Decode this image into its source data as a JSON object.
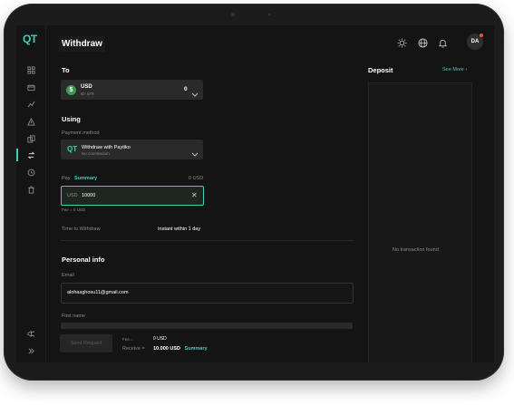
{
  "app": {
    "logo": "QT",
    "page_title": "Withdraw"
  },
  "header": {
    "avatar_initials": "DA"
  },
  "to": {
    "label": "To",
    "currency": {
      "name": "USD",
      "id": "ID: 679",
      "balance": "0",
      "icon": "dollar-icon"
    }
  },
  "using": {
    "label": "Using",
    "payment_method_label": "Payment method",
    "method_logo": "QT",
    "method_name": "Withdraw with Paytiko",
    "method_sub": "No commission"
  },
  "pay": {
    "label": "Pay",
    "summary_link": "Summary",
    "amount_right": "0 USD",
    "currency_prefix": "USD",
    "amount_value": "10000",
    "fee_note": "Fee = 0 USD"
  },
  "time": {
    "label": "Time to Withdraw",
    "value": "Instant within 1 day"
  },
  "personal": {
    "label": "Personal info",
    "email_label": "Email",
    "email_value": "alohasghosu11@gmail.com",
    "first_name_label": "First name"
  },
  "bottom": {
    "send_label": "Send Request",
    "fee_label": "Fee =",
    "fee_value": "0 USD",
    "receive_label": "Receive =",
    "receive_value": "10.000 USD",
    "summary_link": "Summary"
  },
  "deposit": {
    "title": "Deposit",
    "see_more": "See More",
    "empty_text": "No transaction found"
  },
  "colors": {
    "accent": "#3fd1b8",
    "background": "#141414",
    "field": "#2a2a2a"
  }
}
